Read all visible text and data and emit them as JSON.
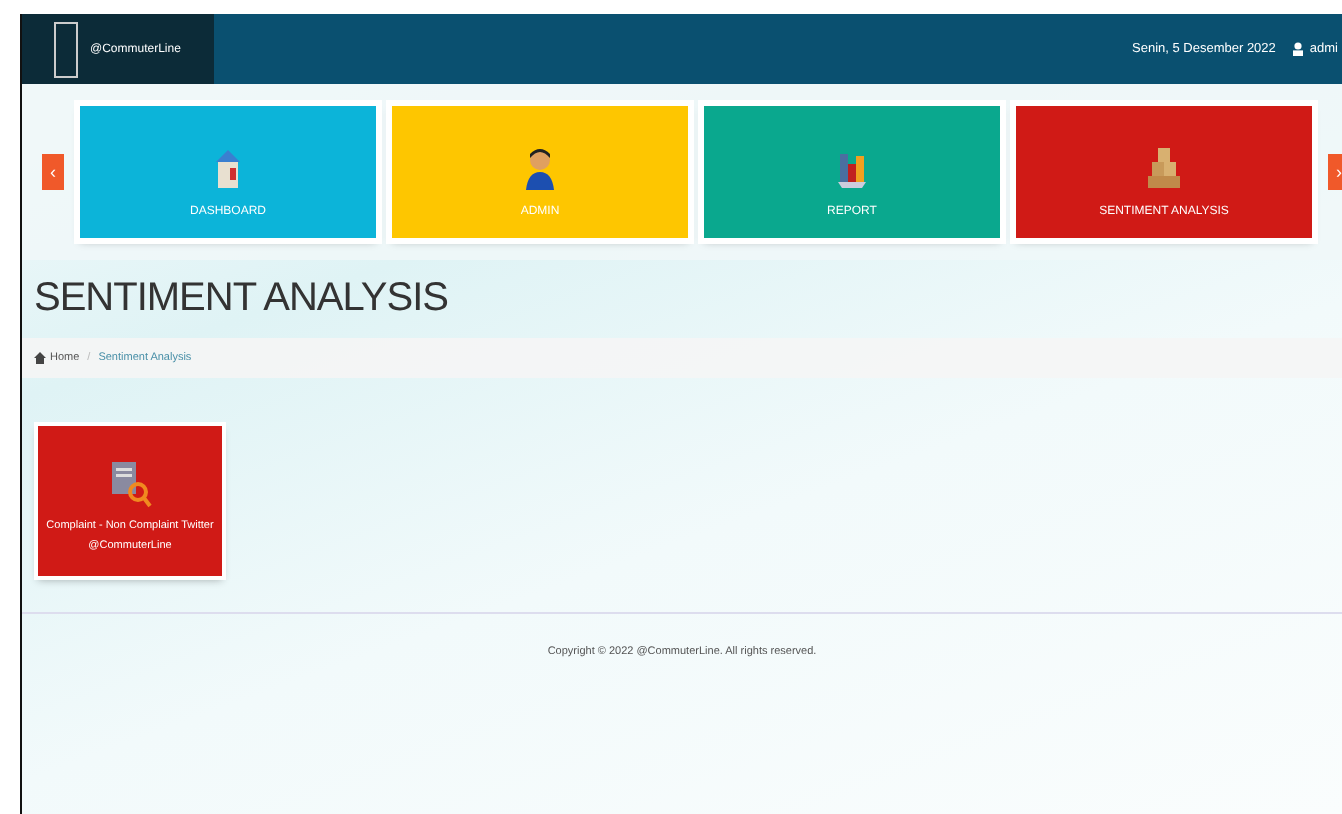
{
  "navbar": {
    "brand": "@CommuterLine",
    "date": "Senin, 5 Desember 2022",
    "user": "admi"
  },
  "carousel": {
    "prev": "‹",
    "next": "›",
    "tiles": [
      {
        "label": "DASHBOARD",
        "color": "#0cb4d9",
        "kind": "building"
      },
      {
        "label": "ADMIN",
        "color": "#fec600",
        "kind": "person"
      },
      {
        "label": "REPORT",
        "color": "#0aa88e",
        "kind": "chart"
      },
      {
        "label": "SENTIMENT ANALYSIS",
        "color": "#d01a16",
        "kind": "boxes"
      }
    ]
  },
  "page_title": "SENTIMENT ANALYSIS",
  "breadcrumb": {
    "home": "Home",
    "separator": "/",
    "current": "Sentiment Analysis"
  },
  "cards": [
    {
      "label": "Complaint - Non Complaint Twitter @CommuterLine",
      "color": "#d01a16"
    }
  ],
  "footer": "Copyright © 2022 @CommuterLine. All rights reserved."
}
